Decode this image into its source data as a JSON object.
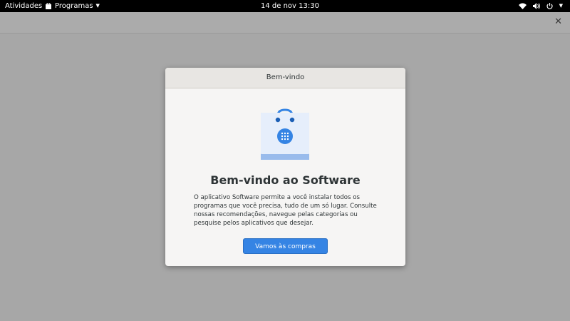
{
  "topbar": {
    "activities": "Atividades",
    "apps_menu": "Programas",
    "datetime": "14 de nov  13:30"
  },
  "dialog": {
    "title": "Bem-vindo",
    "heading": "Bem-vindo ao Software",
    "body": "O aplicativo Software permite a você instalar todos os programas que você precisa, tudo de um só lugar. Consulte nossas recomendações, navegue pelas categorias ou pesquise pelos aplicativos que desejar.",
    "button": "Vamos às compras"
  },
  "colors": {
    "accent": "#3584e4",
    "topbar": "#000000",
    "backdrop": "#a7a7a7"
  },
  "icons": [
    "shopping-bag-icon",
    "wifi-icon",
    "volume-icon",
    "power-icon",
    "close-icon"
  ]
}
